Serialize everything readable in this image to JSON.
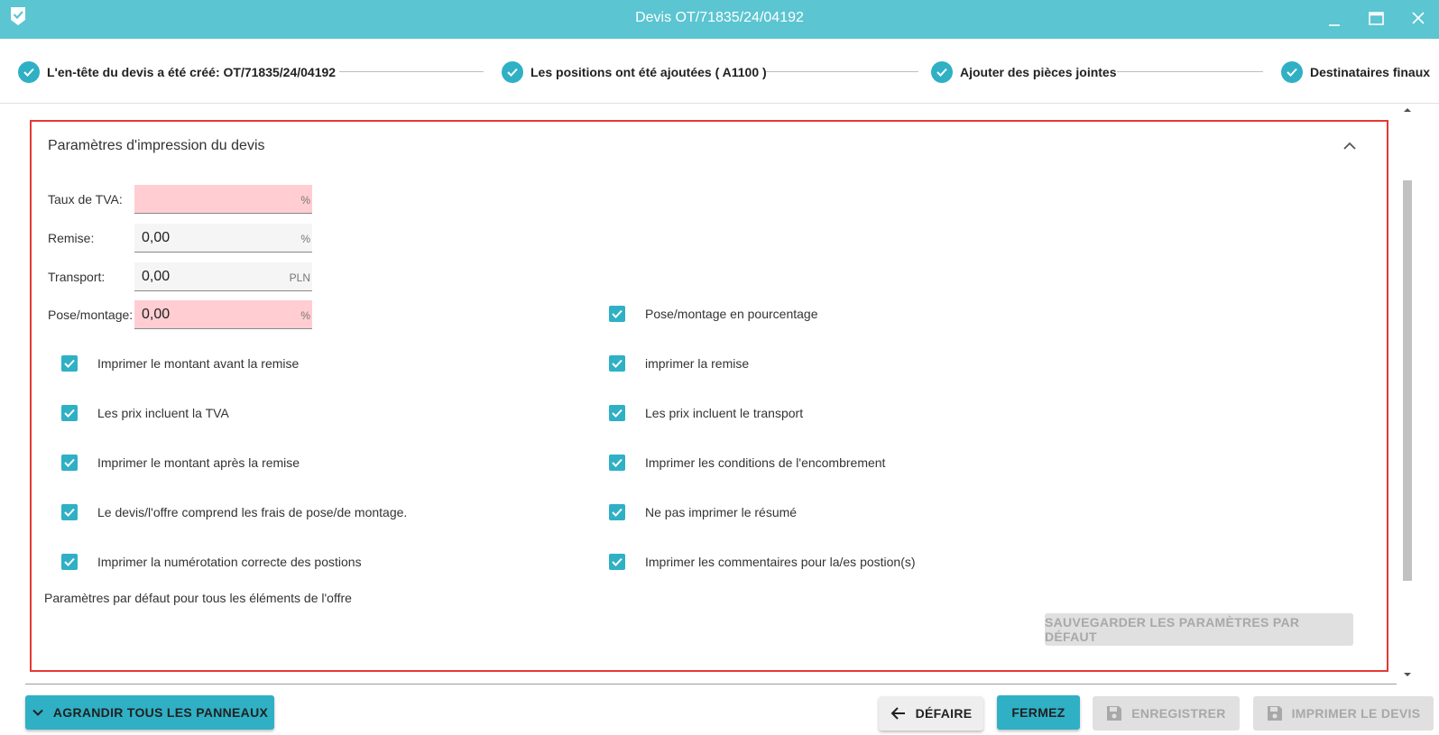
{
  "window": {
    "title": "Devis OT/71835/24/04192"
  },
  "stepper": {
    "steps": [
      {
        "label": "L'en-tête du devis a été créé: OT/71835/24/04192"
      },
      {
        "label": "Les positions ont été ajoutées ( A1100 )"
      },
      {
        "label": "Ajouter des pièces jointes"
      },
      {
        "label": "Destinataires finaux"
      }
    ]
  },
  "panel": {
    "title": "Paramètres d'impression du devis",
    "fields": {
      "vat": {
        "label": "Taux de TVA:",
        "value": "",
        "unit": "%"
      },
      "discount": {
        "label": "Remise:",
        "value": "0,00",
        "unit": "%"
      },
      "transport": {
        "label": "Transport:",
        "value": "0,00",
        "unit": "PLN"
      },
      "installation": {
        "label": "Pose/montage:",
        "value": "0,00",
        "unit": "%"
      }
    },
    "checkboxes_right": [
      {
        "label": "Pose/montage en pourcentage",
        "checked": true
      },
      {
        "label": "imprimer la remise",
        "checked": true
      },
      {
        "label": "Les prix incluent le transport",
        "checked": true
      },
      {
        "label": "Imprimer les conditions de l'encombrement",
        "checked": true
      },
      {
        "label": "Ne pas imprimer le résumé",
        "checked": true
      },
      {
        "label": "Imprimer les commentaires pour la/es pos​tion(s)",
        "checked": true
      }
    ],
    "checkboxes_left": [
      {
        "label": "Imprimer le montant avant la remise",
        "checked": true
      },
      {
        "label": "Les prix incluent la TVA",
        "checked": true
      },
      {
        "label": "Imprimer le montant après la remise",
        "checked": true
      },
      {
        "label": "Le devis/l'offre comprend les frais de pose/de montage.",
        "checked": true
      },
      {
        "label": "Imprimer la numérotation correcte des postions",
        "checked": true
      }
    ],
    "default_text": "Paramètres par défaut pour tous les éléments de l'offre",
    "save_default_label": "SAUVEGARDER LES PARAMÈTRES PAR DÉFAUT"
  },
  "footer": {
    "expand_label": "AGRANDIR TOUS LES PANNEAUX",
    "undo_label": "DÉFAIRE",
    "close_label": "FERMEZ",
    "save_label": "ENREGISTRER",
    "print_label": "IMPRIMER LE DEVIS"
  },
  "colors": {
    "titlebar": "#5bc5d1",
    "accent": "#2fb0c5",
    "error_field": "#ffcdd2",
    "highlight_border": "#e53935"
  }
}
